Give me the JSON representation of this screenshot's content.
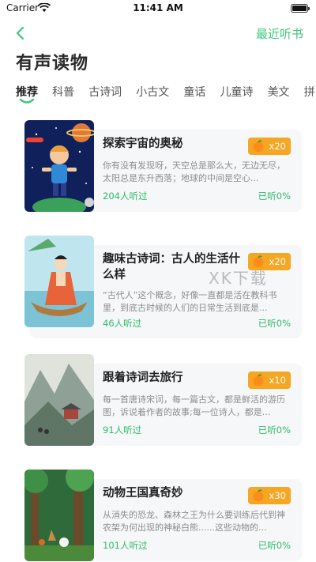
{
  "status_bar": {
    "carrier": "Carrier",
    "time": "11:41 AM"
  },
  "nav": {
    "action_label": "最近听书"
  },
  "page": {
    "title": "有声读物"
  },
  "tabs": [
    {
      "label": "推荐",
      "active": true
    },
    {
      "label": "科普"
    },
    {
      "label": "古诗词"
    },
    {
      "label": "小古文"
    },
    {
      "label": "童话"
    },
    {
      "label": "儿童诗"
    },
    {
      "label": "美文"
    },
    {
      "label": "拼"
    }
  ],
  "books": [
    {
      "title": "探索宇宙的奥秘",
      "description": "你有没有发现呀，天空总是那么大，无边无尽，太阳总是东升西落；地球的中间是空心...",
      "listeners": "204人听过",
      "progress": "已听0%",
      "price": "x20",
      "cover_icon": "space-boy-cover"
    },
    {
      "title": "趣味古诗词：古人的生活什么样",
      "description": "“古代人”这个概念，好像一直都是活在教科书里，到底古时候的人们的日常生活到底是...",
      "listeners": "46人听过",
      "progress": "已听0%",
      "price": "x20",
      "cover_icon": "ancient-girl-boat-cover"
    },
    {
      "title": "跟着诗词去旅行",
      "description": "每一首唐诗宋词，每一篇古文，都是鲜活的游历图，诉说着作者的故事;每一位诗人，都是...",
      "listeners": "91人听过",
      "progress": "已听0%",
      "price": "x10",
      "cover_icon": "landscape-painting-cover"
    },
    {
      "title": "动物王国真奇妙",
      "description": "从消失的恐龙、森林之王为什么要训练后代到神农架为何出现的神秘白熊......这些动物的...",
      "listeners": "101人听过",
      "progress": "已听0%",
      "price": "x30",
      "cover_icon": "forest-animals-cover"
    }
  ],
  "watermark": "XK下载",
  "colors": {
    "accent": "#3cc87a",
    "badge": "#f5a623",
    "card_bg": "#f6f7f8"
  }
}
